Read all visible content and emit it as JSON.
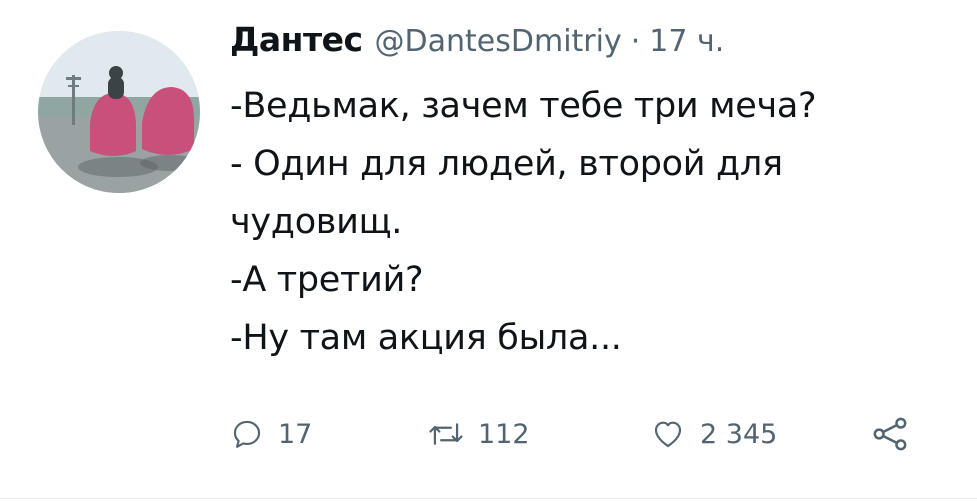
{
  "tweet": {
    "author_name": "Дантес",
    "author_handle": "@DantesDmitriy",
    "separator": "·",
    "time_ago": "17 ч.",
    "lines": [
      "-Ведьмак, зачем тебе три меча?",
      "- Один для людей, второй для",
      "чудовищ.",
      "-А третий?",
      "-Ну там акция была..."
    ]
  },
  "actions": {
    "reply": {
      "icon": "reply-icon",
      "count": "17"
    },
    "retweet": {
      "icon": "retweet-icon",
      "count": "112"
    },
    "like": {
      "icon": "heart-icon",
      "count": "2 345"
    },
    "share": {
      "icon": "share-icon"
    }
  },
  "colors": {
    "text": "#0f1419",
    "secondary": "#536471",
    "background": "#ffffff",
    "avatar_accent": "#c8507a"
  }
}
